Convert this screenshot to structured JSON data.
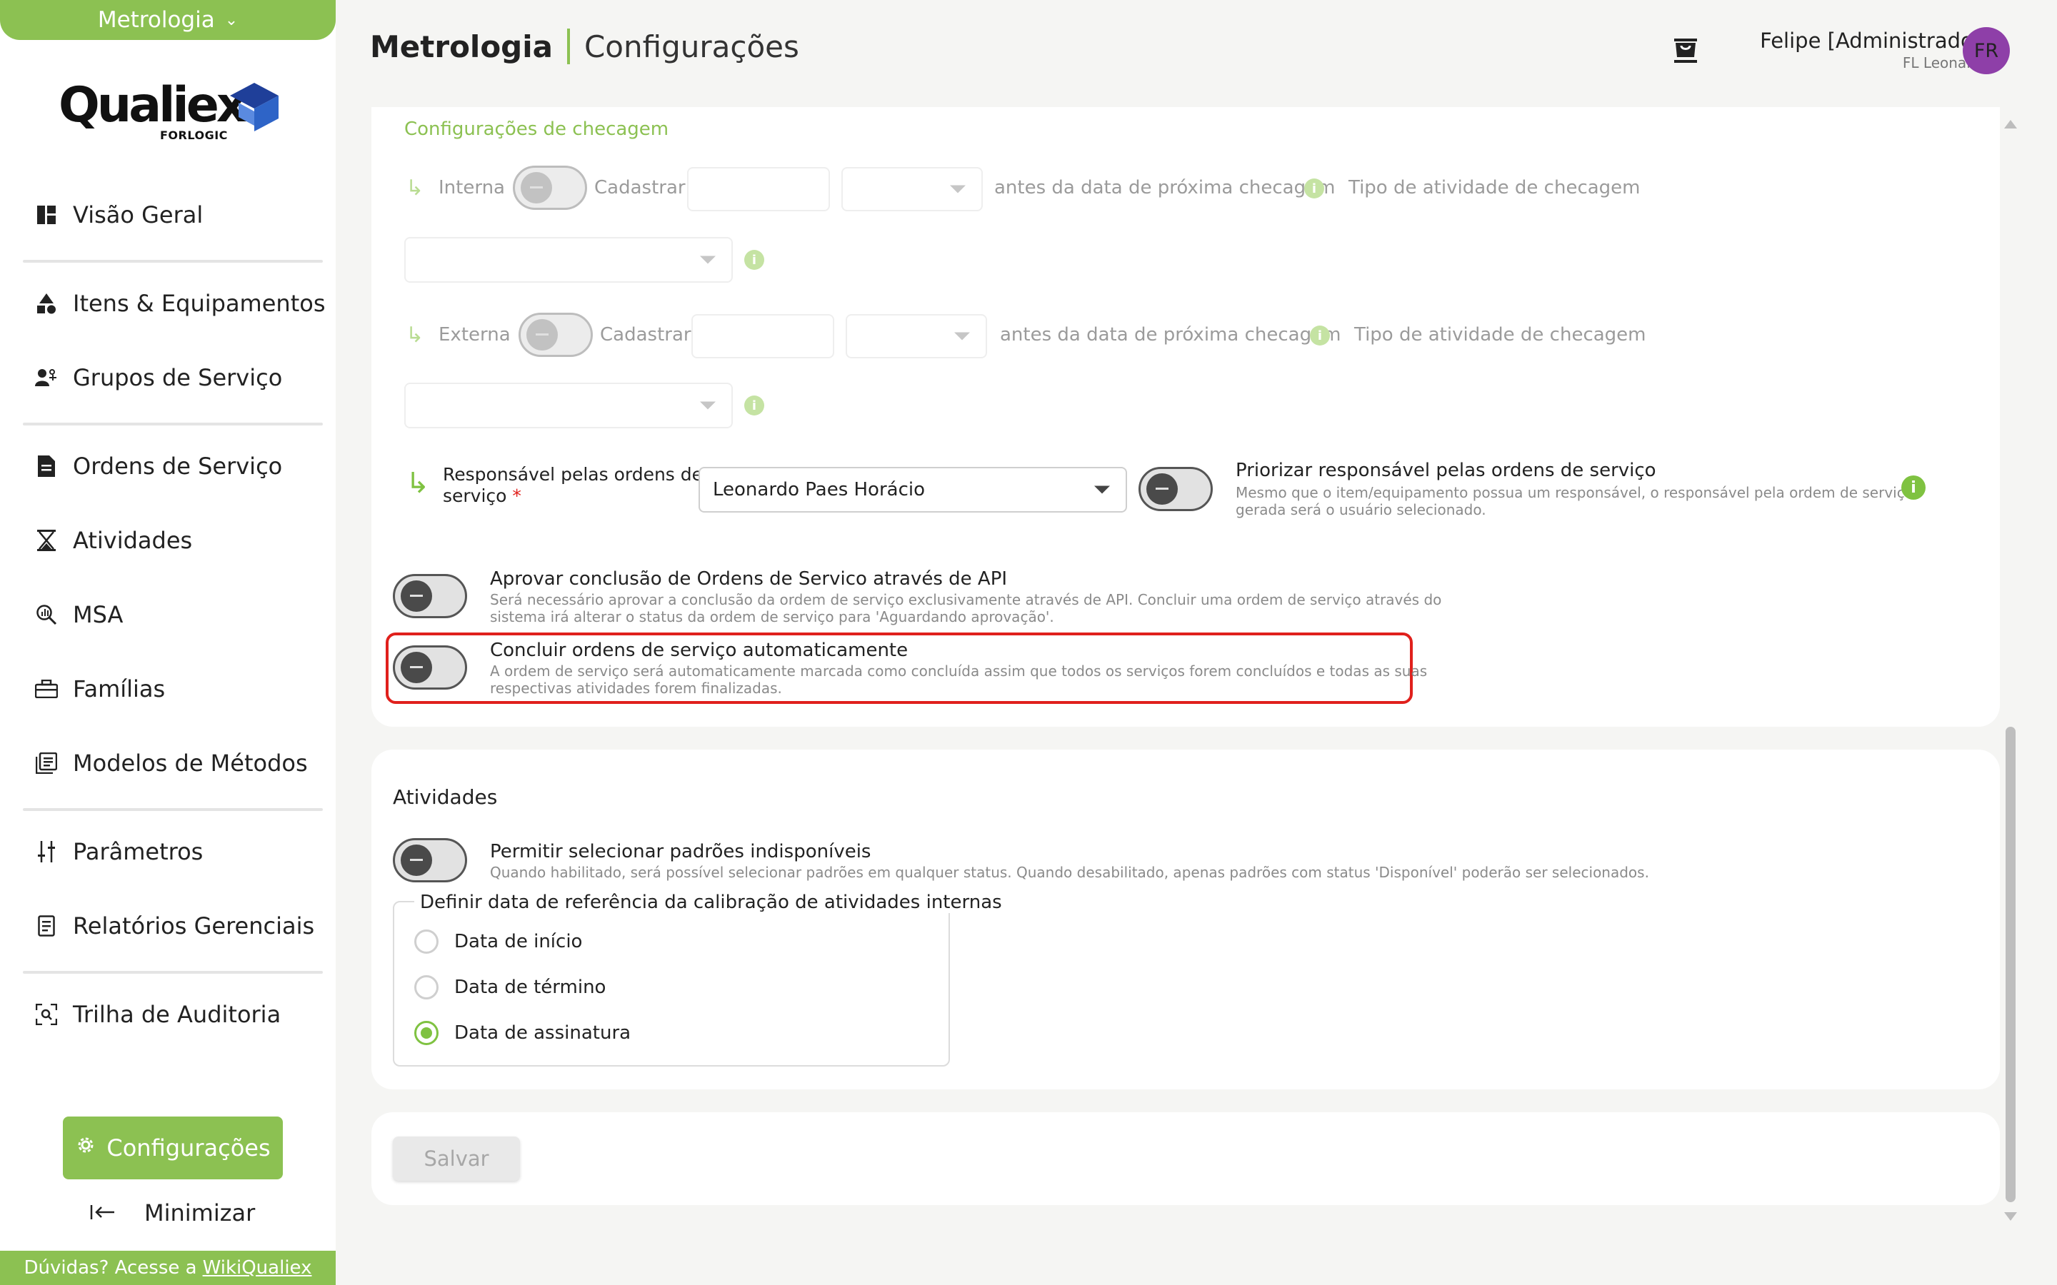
{
  "sidebar": {
    "module": "Metrologia",
    "logo": {
      "word": "Qualiex",
      "sub": "FORLOGIC"
    },
    "items": [
      {
        "label": "Visão Geral"
      },
      {
        "label": "Itens & Equipamentos"
      },
      {
        "label": "Grupos de Serviço"
      },
      {
        "label": "Ordens de Serviço"
      },
      {
        "label": "Atividades"
      },
      {
        "label": "MSA"
      },
      {
        "label": "Famílias"
      },
      {
        "label": "Modelos de Métodos"
      },
      {
        "label": "Parâmetros"
      },
      {
        "label": "Relatórios Gerenciais"
      },
      {
        "label": "Trilha de Auditoria"
      }
    ],
    "config_label": "Configurações",
    "minimize_label": "Minimizar",
    "help_text": "Dúvidas? Acesse a",
    "help_link": "WikiQualiex"
  },
  "header": {
    "app": "Metrologia",
    "page": "Configurações",
    "user_name": "Felipe [Administrador]",
    "user_company": "FL Leonardo",
    "avatar_initials": "FR"
  },
  "checagem": {
    "title": "Configurações de checagem",
    "interna_label": "Interna",
    "externa_label": "Externa",
    "cadastrar_label": "Cadastrar",
    "antes_label": "antes da data de próxima checagem",
    "tipo_label": "Tipo de atividade de checagem",
    "responsavel_label_1": "Responsável pelas ordens de",
    "responsavel_label_2": "serviço",
    "required_mark": "*",
    "responsavel_value": "Leonardo Paes Horácio",
    "priorizar_title": "Priorizar responsável pelas ordens de serviço",
    "priorizar_desc_1": "Mesmo que o item/equipamento possua um responsável, o responsável pela ordem de serviço",
    "priorizar_desc_2": "gerada será o usuário selecionado."
  },
  "options": {
    "aprovar_title": "Aprovar conclusão de Ordens de Servico através de API",
    "aprovar_desc_1": "Será necessário aprovar a conclusão da ordem de serviço exclusivamente através de API. Concluir uma ordem de serviço através do",
    "aprovar_desc_2": "sistema irá alterar o status da ordem de serviço para 'Aguardando aprovação'.",
    "concluir_title": "Concluir ordens de serviço automaticamente",
    "concluir_desc_1": "A ordem de serviço será automaticamente marcada como concluída assim que todos os serviços forem concluídos e todas as suas",
    "concluir_desc_2": "respectivas atividades forem finalizadas."
  },
  "atividades": {
    "title": "Atividades",
    "permitir_title": "Permitir selecionar padrões indisponíveis",
    "permitir_desc": "Quando habilitado, será possível selecionar padrões em qualquer status. Quando desabilitado, apenas padrões com status 'Disponível' poderão ser selecionados.",
    "fieldset_legend": "Definir data de referência da calibração de atividades internas",
    "radios": [
      {
        "label": "Data de início",
        "checked": false
      },
      {
        "label": "Data de término",
        "checked": false
      },
      {
        "label": "Data de assinatura",
        "checked": true
      }
    ]
  },
  "footer": {
    "save_label": "Salvar"
  },
  "colors": {
    "brand_green": "#8cc152",
    "highlight_red": "#e0201c",
    "avatar_purple": "#8e3fa8"
  }
}
